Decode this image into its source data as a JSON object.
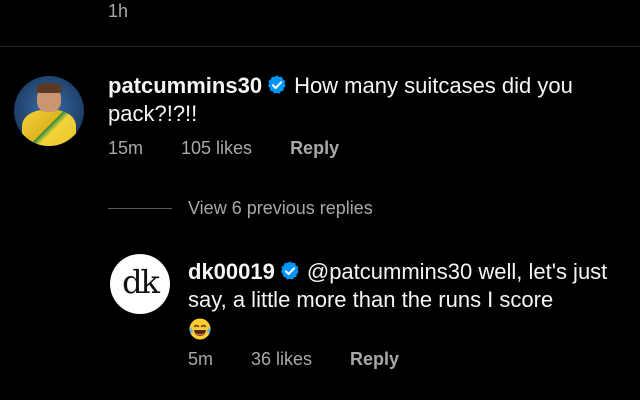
{
  "top_time": "1h",
  "comments": [
    {
      "username": "patcummins30",
      "verified": true,
      "text": "How many suitcases did you pack?!?!!",
      "time": "15m",
      "likes": "105 likes",
      "reply_label": "Reply"
    }
  ],
  "view_replies_label": "View 6 previous replies",
  "reply": {
    "username": "dk00019",
    "verified": true,
    "avatar_text": "dk",
    "mention": "@patcummins30",
    "text": "well,  let's just say, a little more than the runs I score",
    "emoji": "laughing-crying-emoji",
    "time": "5m",
    "likes": "36 likes",
    "reply_label": "Reply"
  },
  "colors": {
    "background": "#000000",
    "text_primary": "#f5f5f5",
    "text_secondary": "#a8a8a8",
    "verified_blue": "#0095f6"
  }
}
